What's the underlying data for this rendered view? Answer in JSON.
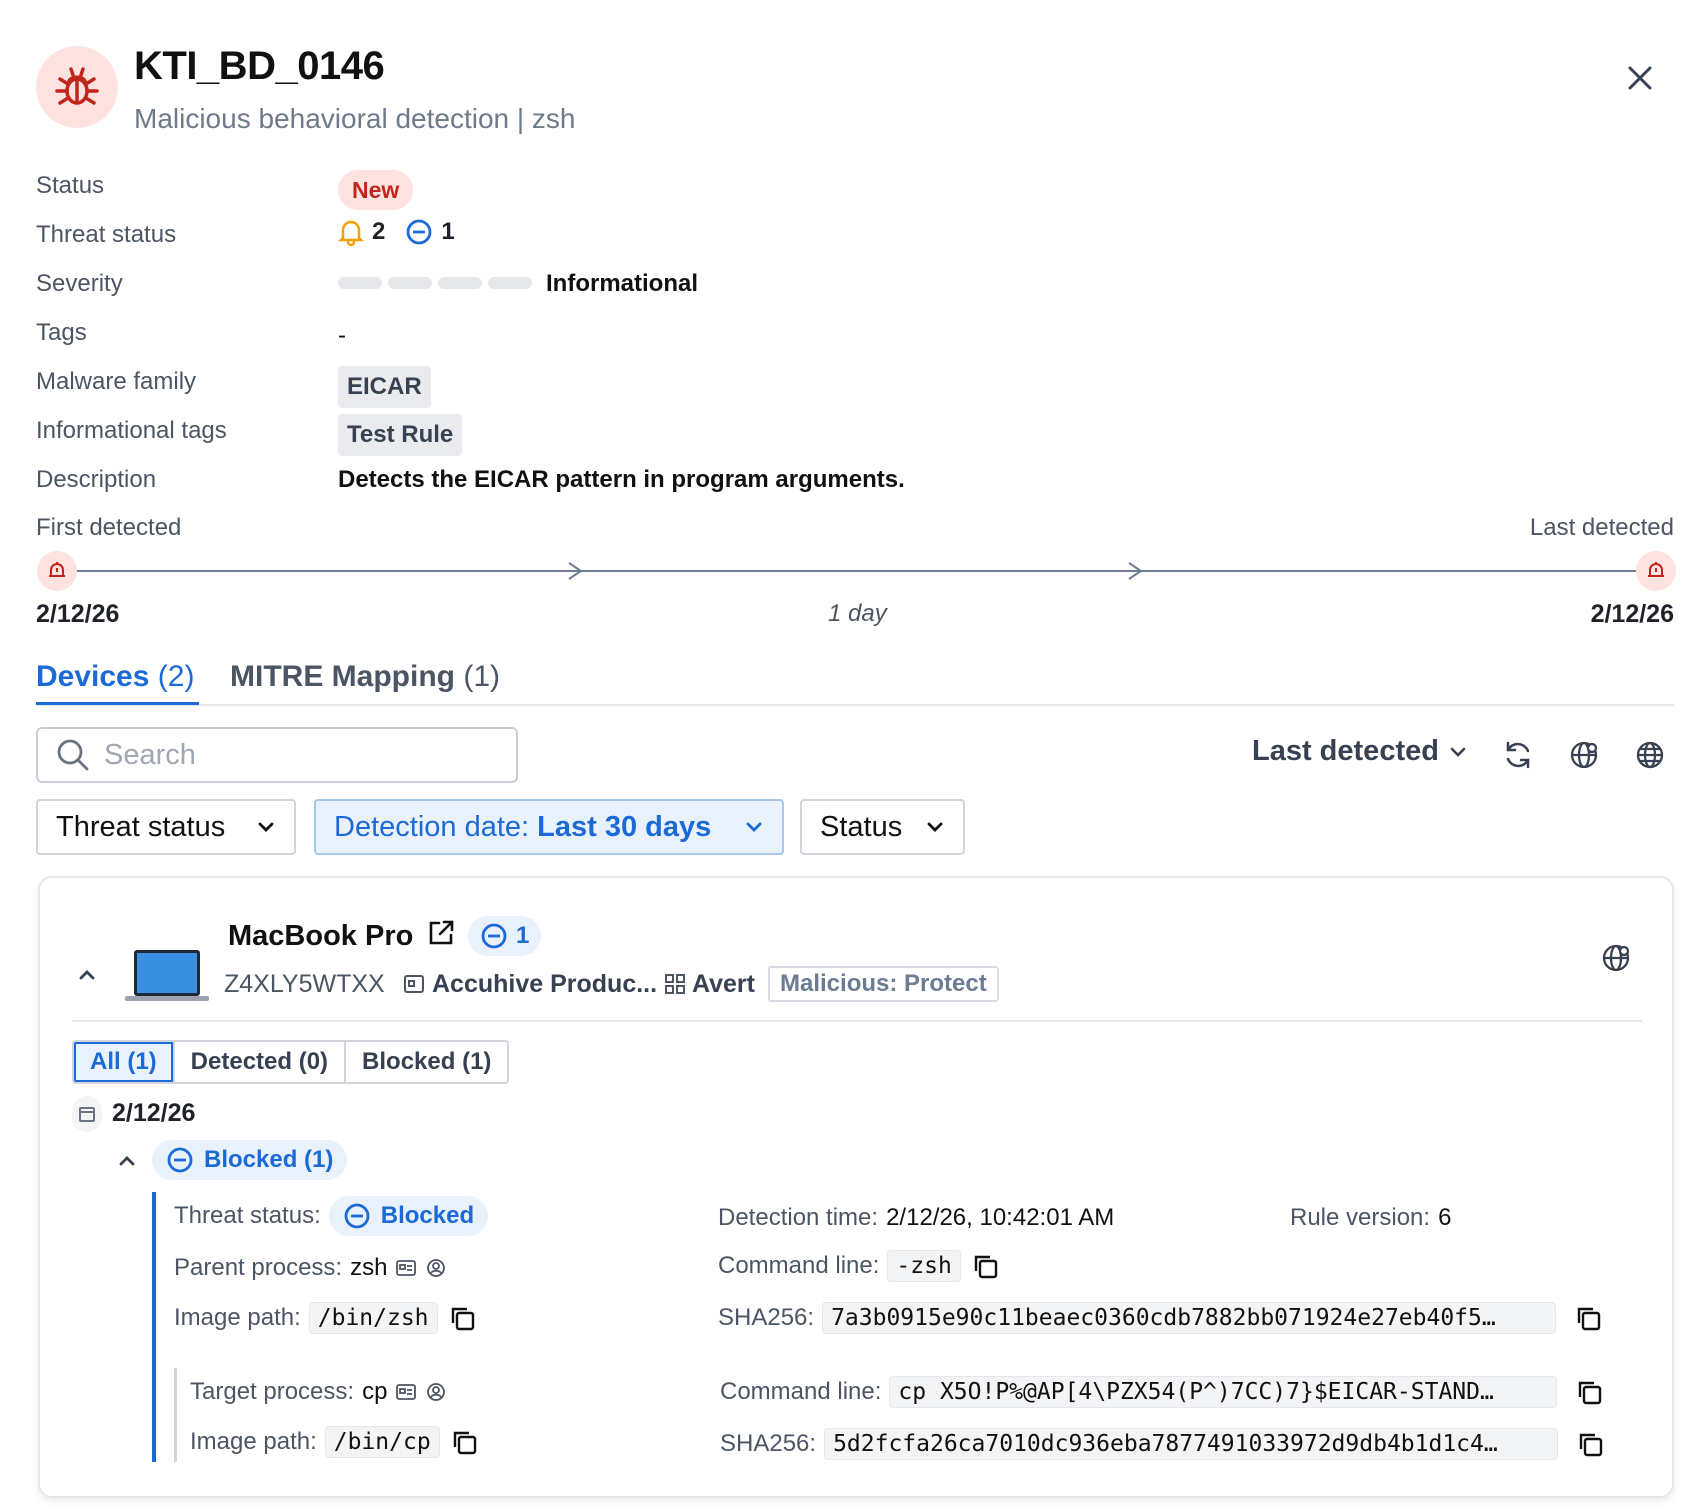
{
  "header": {
    "title": "KTI_BD_0146",
    "subtitle": "Malicious behavioral detection | zsh"
  },
  "details": {
    "status_label": "Status",
    "status_value": "New",
    "threat_status_label": "Threat status",
    "threat_alert_count": "2",
    "threat_blocked_count": "1",
    "severity_label": "Severity",
    "severity_value": "Informational",
    "severity_level": 0,
    "tags_label": "Tags",
    "tags_value": "-",
    "malware_family_label": "Malware family",
    "malware_family_value": "EICAR",
    "info_tags_label": "Informational tags",
    "info_tags_value": "Test Rule",
    "description_label": "Description",
    "description_value": "Detects the EICAR pattern in program arguments."
  },
  "timeline": {
    "first_label": "First detected",
    "last_label": "Last detected",
    "first_date": "2/12/26",
    "last_date": "2/12/26",
    "duration": "1 day"
  },
  "tabs": [
    {
      "label": "Devices",
      "count": "(2)"
    },
    {
      "label": "MITRE Mapping",
      "count": "(1)"
    }
  ],
  "toolbar": {
    "search_placeholder": "Search",
    "sort_label": "Last detected"
  },
  "filters": {
    "threat_status": "Threat status",
    "detection_prefix": "Detection date: ",
    "detection_value": "Last 30 days",
    "status": "Status"
  },
  "device": {
    "name": "MacBook Pro",
    "blocked_count": "1",
    "serial": "Z4XLY5WTXX",
    "org": "Accuhive Produc...",
    "group": "Avert",
    "policy": "Malicious: Protect",
    "segments": [
      "All (1)",
      "Detected (0)",
      "Blocked (1)"
    ],
    "date": "2/12/26",
    "group_label": "Blocked (1)"
  },
  "event": {
    "threat_status_label": "Threat status:",
    "threat_status_value": "Blocked",
    "detection_time_label": "Detection time:",
    "detection_time_value": "2/12/26, 10:42:01 AM",
    "rule_version_label": "Rule version:",
    "rule_version_value": "6",
    "parent_process_label": "Parent process:",
    "parent_process_value": "zsh",
    "parent_cmd_label": "Command line:",
    "parent_cmd_value": "-zsh",
    "parent_image_label": "Image path:",
    "parent_image_value": "/bin/zsh",
    "parent_sha_label": "SHA256:",
    "parent_sha_value": "7a3b0915e90c11beaec0360cdb7882bb071924e27eb40f5…",
    "target_process_label": "Target process:",
    "target_process_value": "cp",
    "target_cmd_label": "Command line:",
    "target_cmd_value": "cp X5O!P%@AP[4\\PZX54(P^)7CC)7}$EICAR-STAND…",
    "target_image_label": "Image path:",
    "target_image_value": "/bin/cp",
    "target_sha_label": "SHA256:",
    "target_sha_value": "5d2fcfa26ca7010dc936eba7877491033972d9db4b1d1c4…"
  },
  "colors": {
    "accent": "#1b6ad6",
    "danger": "#c0261b",
    "danger_bg": "#fde2e0",
    "warn": "#f59e0b"
  }
}
